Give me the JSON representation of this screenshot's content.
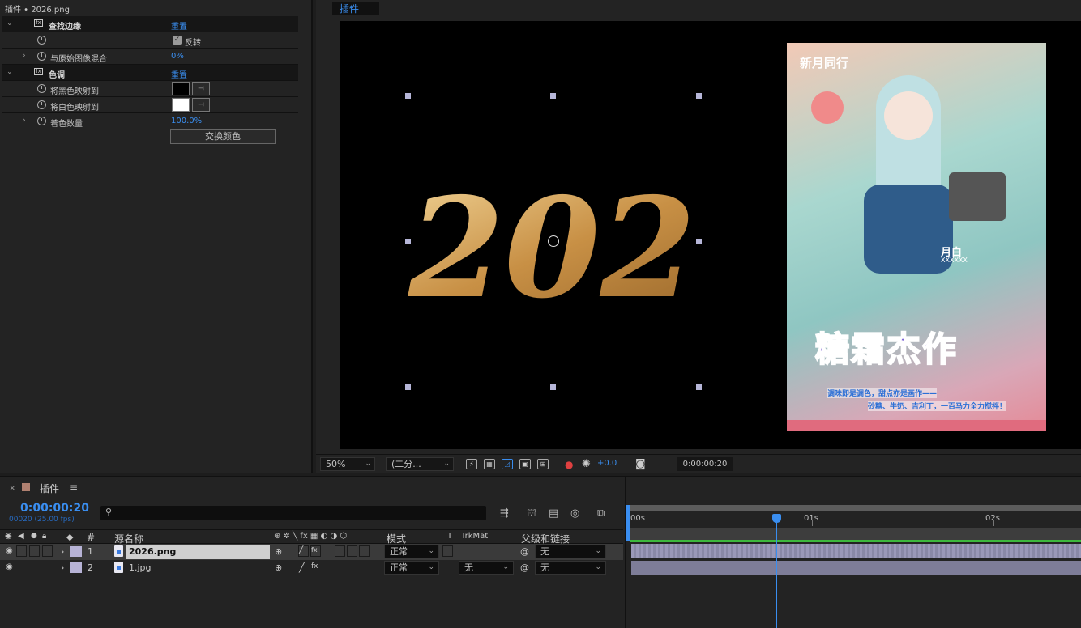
{
  "effect_controls": {
    "title": "插件 • 2026.png",
    "effects": [
      {
        "name": "查找边缘",
        "reset": "重置"
      },
      {
        "name": "色调",
        "reset": "重置"
      }
    ],
    "props": {
      "invert_label": "反转",
      "blend_label": "与原始图像混合",
      "blend_value": "0%",
      "map_black_label": "将黑色映射到",
      "map_white_label": "将白色映射到",
      "amount_label": "着色数量",
      "amount_value": "100.0%",
      "swap_button": "交换颜色"
    },
    "colors": {
      "black_map": "#000000",
      "white_map": "#ffffff"
    }
  },
  "viewer": {
    "tab": "插件",
    "zoom": "50%",
    "resolution": "(二分...",
    "exposure": "+0.0",
    "timecode": "0:00:00:20",
    "canvas_text": "2026",
    "poster": {
      "header": "新月同行",
      "tag": "月白",
      "tag_sub": "XXXXXX",
      "title": "糖霜杰作",
      "caption_1": "调味即是调色，甜点亦是画作——",
      "caption_2": "砂糖、牛奶、吉利丁，一百马力全力搅拌！"
    }
  },
  "timeline": {
    "tab": "插件",
    "timecode": "0:00:00:20",
    "frame_info": "00020 (25.00 fps)",
    "columns": {
      "num": "#",
      "source": "源名称",
      "mode": "模式",
      "t": "T",
      "trkmat": "TrkMat",
      "parent": "父级和链接"
    },
    "layers": [
      {
        "num": "1",
        "name": "2026.png",
        "mode": "正常",
        "trkmat": "",
        "parent": "无"
      },
      {
        "num": "2",
        "name": "1.jpg",
        "mode": "正常",
        "trkmat": "无",
        "parent": "无"
      }
    ],
    "ruler": [
      "00s",
      "01s",
      "02s"
    ],
    "colors": {
      "playhead": "#3a8ef0",
      "layer_label": "#b7b3d6",
      "work_area": "#3db83d"
    }
  }
}
